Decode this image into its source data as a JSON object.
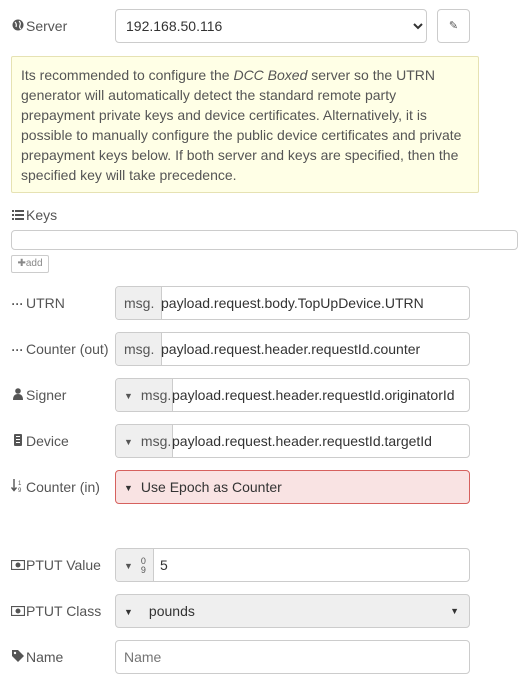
{
  "server": {
    "label": "Server",
    "value": "192.168.50.116",
    "edit_icon": "pencil-icon"
  },
  "info": {
    "part1": "Its recommended to configure the ",
    "emph": "DCC Boxed",
    "part2": " server so the UTRN generator will automatically detect the standard remote party prepayment private keys and device certificates. Alternatively, it is possible to manually configure the public device certificates and private prepayment keys below. If both server and keys are specified, then the specified key will take precedence."
  },
  "keys": {
    "label": "Keys",
    "add_label": "add"
  },
  "fields": {
    "utrn": {
      "label": "UTRN",
      "type": "msg.",
      "value": "payload.request.body.TopUpDevice.UTRN"
    },
    "counter_out": {
      "label": "Counter (out)",
      "type": "msg.",
      "value": "payload.request.header.requestId.counter"
    },
    "signer": {
      "label": "Signer",
      "type": "msg.",
      "value": "payload.request.header.requestId.originatorId"
    },
    "device": {
      "label": "Device",
      "type": "msg.",
      "value": "payload.request.header.requestId.targetId"
    },
    "counter_in": {
      "label": "Counter (in)",
      "value": "Use Epoch as Counter"
    },
    "ptut_value": {
      "label": "PTUT Value",
      "type_glyph_top": "0",
      "type_glyph_bottom": "9",
      "value": "5"
    },
    "ptut_class": {
      "label": "PTUT Class",
      "value": "pounds"
    },
    "name": {
      "label": "Name",
      "placeholder": "Name"
    }
  }
}
